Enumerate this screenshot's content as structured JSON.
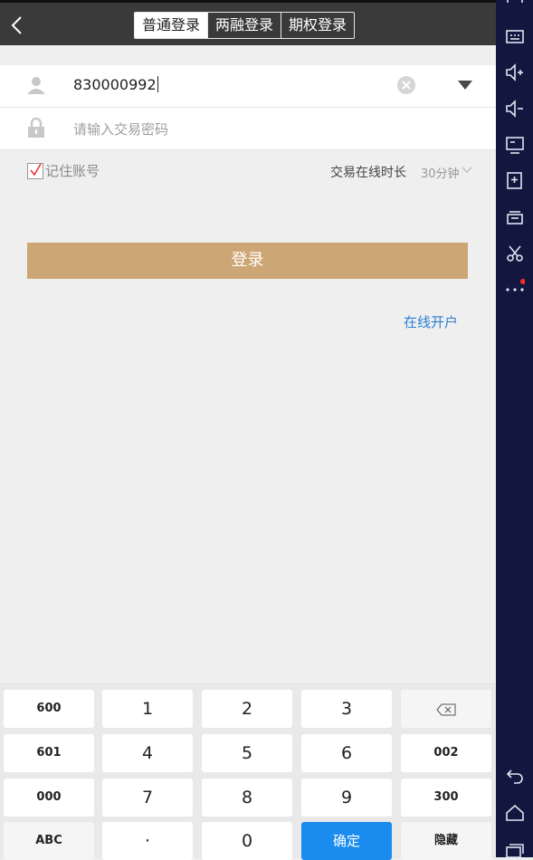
{
  "header": {
    "tabs": [
      "普通登录",
      "两融登录",
      "期权登录"
    ]
  },
  "form": {
    "account_value": "830000992",
    "password_placeholder": "请输入交易密码"
  },
  "options": {
    "remember_label": "记住账号",
    "online_label": "交易在线时长",
    "duration_value": "30分钟"
  },
  "actions": {
    "login_label": "登录",
    "open_account_label": "在线开户"
  },
  "keyboard": {
    "rows": [
      [
        "600",
        "1",
        "2",
        "3",
        "⌫"
      ],
      [
        "601",
        "4",
        "5",
        "6",
        "002"
      ],
      [
        "000",
        "7",
        "8",
        "9",
        "300"
      ],
      [
        "ABC",
        "·",
        "0",
        "确定",
        "隐藏"
      ]
    ]
  },
  "colors": {
    "accent_login": "#cda675",
    "link": "#2a7fd6",
    "confirm_key": "#1a8cf0",
    "sidebar_bg": "#131740"
  },
  "sidebar": {
    "icons": [
      "fullscreen-icon",
      "keyboard-icon",
      "volume-up-icon",
      "volume-down-icon",
      "screen-icon",
      "apk-install-icon",
      "layers-icon",
      "scissors-icon",
      "more-icon",
      "back-icon",
      "home-icon",
      "recent-apps-icon"
    ]
  }
}
